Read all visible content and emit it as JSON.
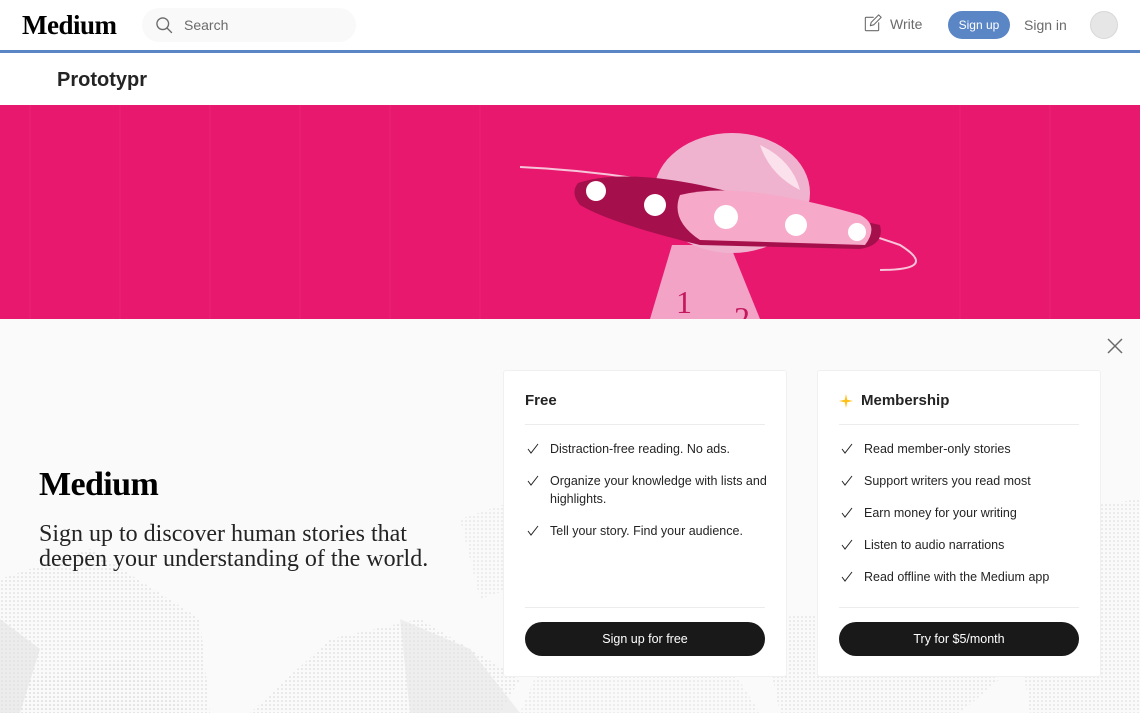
{
  "topnav": {
    "logo": "Medium",
    "search_placeholder": "Search",
    "write_label": "Write",
    "signup_label": "Sign up",
    "signin_label": "Sign in",
    "accent_color": "#5b86c5"
  },
  "publication": {
    "name": "Prototypr"
  },
  "hero": {
    "background_color": "#e8186e",
    "image_description_icon": "ufo-illustration"
  },
  "signup_sheet": {
    "logo": "Medium",
    "headline": "Sign up to discover human stories that deepen your understanding of the world.",
    "plans": {
      "free": {
        "title": "Free",
        "features": [
          "Distraction-free reading. No ads.",
          "Organize your knowledge with lists and highlights.",
          "Tell your story. Find your audience."
        ],
        "button_label": "Sign up for free"
      },
      "membership": {
        "title": "Membership",
        "icon": "star-icon",
        "icon_color": "#ffc017",
        "features": [
          "Read member-only stories",
          "Support writers you read most",
          "Earn money for your writing",
          "Listen to audio narrations",
          "Read offline with the Medium app"
        ],
        "button_label": "Try for $5/month"
      }
    }
  }
}
